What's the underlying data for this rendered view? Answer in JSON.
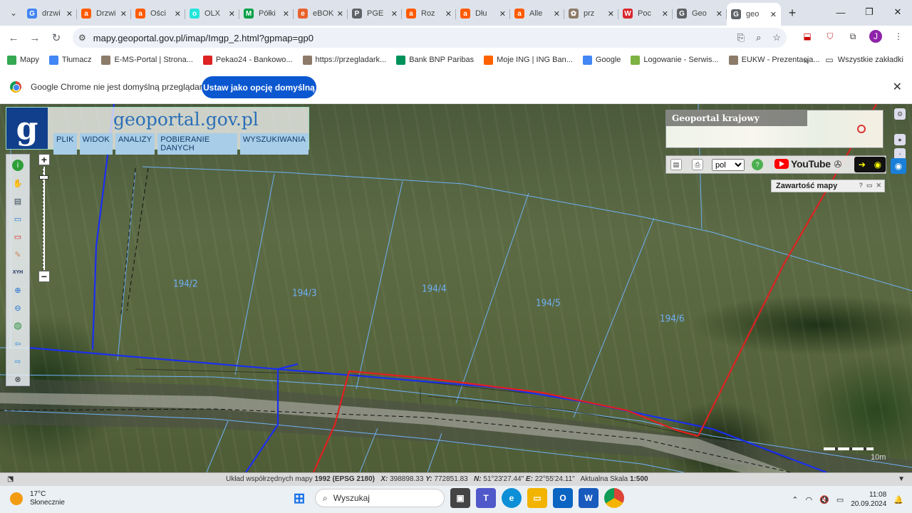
{
  "browser": {
    "tabs": [
      {
        "title": "drzwi",
        "favicon": "G",
        "color": "#4285f4"
      },
      {
        "title": "Drzwi",
        "favicon": "a",
        "color": "#ff5a00"
      },
      {
        "title": "Ości",
        "favicon": "a",
        "color": "#ff5a00"
      },
      {
        "title": "OLX",
        "favicon": "o",
        "color": "#23e5db"
      },
      {
        "title": "Półki",
        "favicon": "M",
        "color": "#00a046"
      },
      {
        "title": "eBOK",
        "favicon": "e",
        "color": "#e8622c"
      },
      {
        "title": "PGE",
        "favicon": "P",
        "color": "#5f6368"
      },
      {
        "title": "Roz",
        "favicon": "a",
        "color": "#ff5a00"
      },
      {
        "title": "Dłu",
        "favicon": "a",
        "color": "#ff5a00"
      },
      {
        "title": "Alle",
        "favicon": "a",
        "color": "#ff5a00"
      },
      {
        "title": "prz",
        "favicon": "✿",
        "color": "#8d7b6a"
      },
      {
        "title": "Poc",
        "favicon": "W",
        "color": "#d9272e"
      },
      {
        "title": "Geo",
        "favicon": "G",
        "color": "#5f6368"
      },
      {
        "title": "geo",
        "favicon": "G",
        "color": "#5f6368",
        "active": true
      }
    ],
    "url": "mapy.geoportal.gov.pl/imap/Imgp_2.html?gpmap=gp0",
    "bookmarks": [
      {
        "label": "Mapy",
        "color": "#34a853"
      },
      {
        "label": "Tłumacz",
        "color": "#4285f4"
      },
      {
        "label": "E-MS-Portal | Strona...",
        "color": "#8d7b6a"
      },
      {
        "label": "Pekao24 - Bankowo...",
        "color": "#d22"
      },
      {
        "label": "https://przegladark...",
        "color": "#8d7b6a"
      },
      {
        "label": "Bank BNP Paribas",
        "color": "#00915a"
      },
      {
        "label": "Moje ING | ING Ban...",
        "color": "#ff6200"
      },
      {
        "label": "Google",
        "color": "#4285f4"
      },
      {
        "label": "Logowanie - Serwis...",
        "color": "#7cb342"
      },
      {
        "label": "EUKW - Prezentacja...",
        "color": "#8d7b6a"
      }
    ],
    "bookmarks_more": "»",
    "all_bookmarks": "Wszystkie zakładki",
    "profile_initial": "J",
    "infobar_message": "Google Chrome nie jest domyślną przeglądarką",
    "infobar_button": "Ustaw jako opcję domyślną"
  },
  "geoportal": {
    "site_title": "geoportal.gov.pl",
    "menu": [
      "PLIK",
      "WIDOK",
      "ANALIZY",
      "POBIERANIE DANYCH",
      "WYSZUKIWANIA"
    ],
    "minimap_label": "Geoportal krajowy",
    "language": "pol",
    "youtube_label": "YouTube",
    "map_content_panel": "Zawartość mapy",
    "parcels": [
      {
        "id": "194/2"
      },
      {
        "id": "194/3"
      },
      {
        "id": "194/4"
      },
      {
        "id": "194/5"
      },
      {
        "id": "194/6"
      }
    ],
    "scale_label": "10m",
    "status": {
      "crs_prefix": "Układ współrzędnych mapy",
      "crs": "1992 (EPSG 2180)",
      "x_label": "X:",
      "x": "398898.33",
      "y_label": "Y:",
      "y": "772851.83",
      "n_label": "N:",
      "n": "51°23'27.44\"",
      "e_label": "E:",
      "e": "22°55'24.11\"",
      "scale_prefix": "Aktualna Skala",
      "scale": "1:500"
    }
  },
  "taskbar": {
    "temperature": "17°C",
    "weather": "Słonecznie",
    "search_placeholder": "Wyszukaj",
    "time": "11:08",
    "date": "20.09.2024"
  }
}
